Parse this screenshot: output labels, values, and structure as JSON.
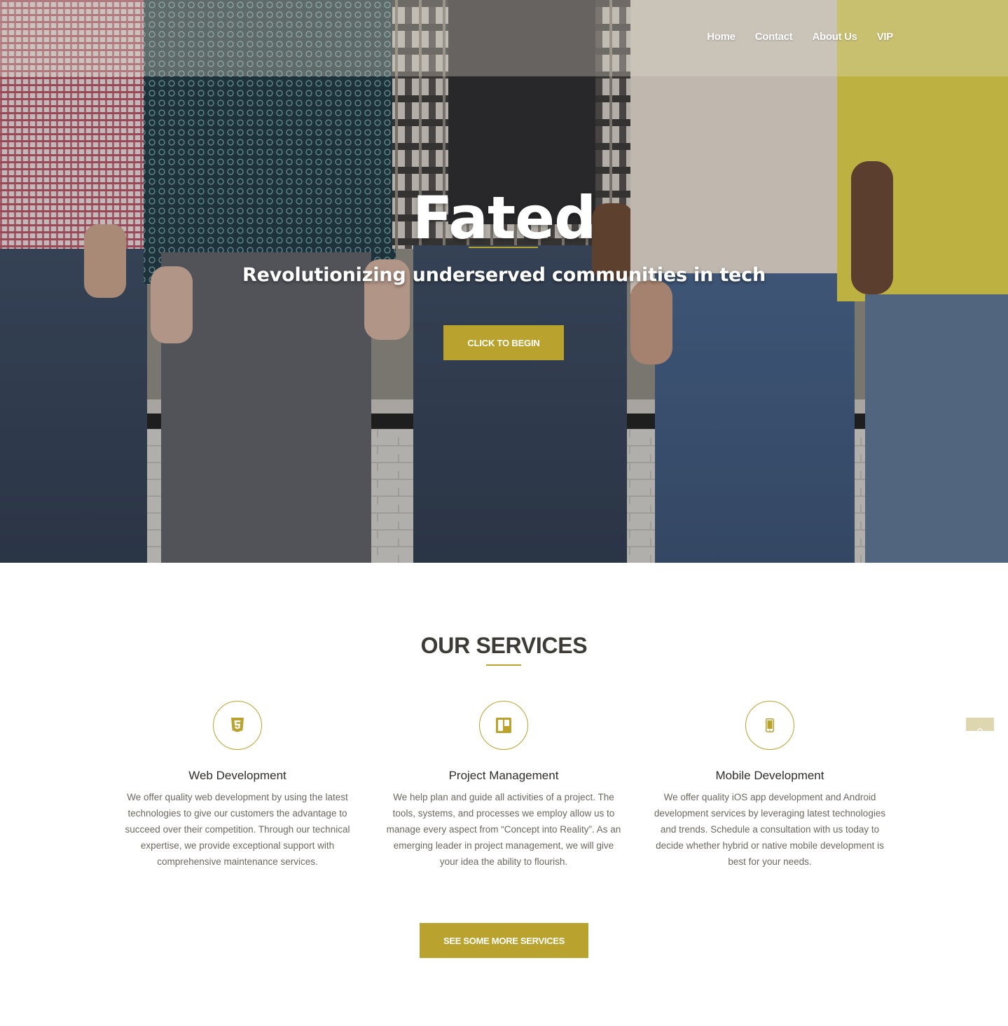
{
  "nav": {
    "items": [
      {
        "label": "Home"
      },
      {
        "label": "Contact"
      },
      {
        "label": "About Us"
      },
      {
        "label": "VIP"
      }
    ]
  },
  "hero": {
    "title": "Fated",
    "subtitle": "Revolutionizing underserved communities in tech",
    "cta_label": "CLICK TO BEGIN"
  },
  "services": {
    "heading": "OUR SERVICES",
    "items": [
      {
        "icon": "html5-icon",
        "title": "Web Development",
        "description": "We offer quality web development by using the latest technologies to give our customers the advantage to succeed over their competition. Through our technical expertise, we provide exceptional support with comprehensive maintenance services."
      },
      {
        "icon": "trello-board-icon",
        "title": "Project Management",
        "description": "We help plan and guide all activities of a project. The tools, systems, and processes we employ allow us to manage every aspect from “Concept into Reality”. As an emerging leader in project management, we will give your idea the ability to flourish."
      },
      {
        "icon": "mobile-phone-icon",
        "title": "Mobile Development",
        "description": "We offer quality iOS app development and Android development services by leveraging latest technologies and trends. Schedule a consultation with us today to decide whether hybrid or native mobile development is best for your needs."
      }
    ],
    "more_label": "SEE SOME MORE SERVICES"
  },
  "colors": {
    "accent": "#b9a22e",
    "heading": "#3d3b36",
    "body_text": "#6b6860"
  }
}
